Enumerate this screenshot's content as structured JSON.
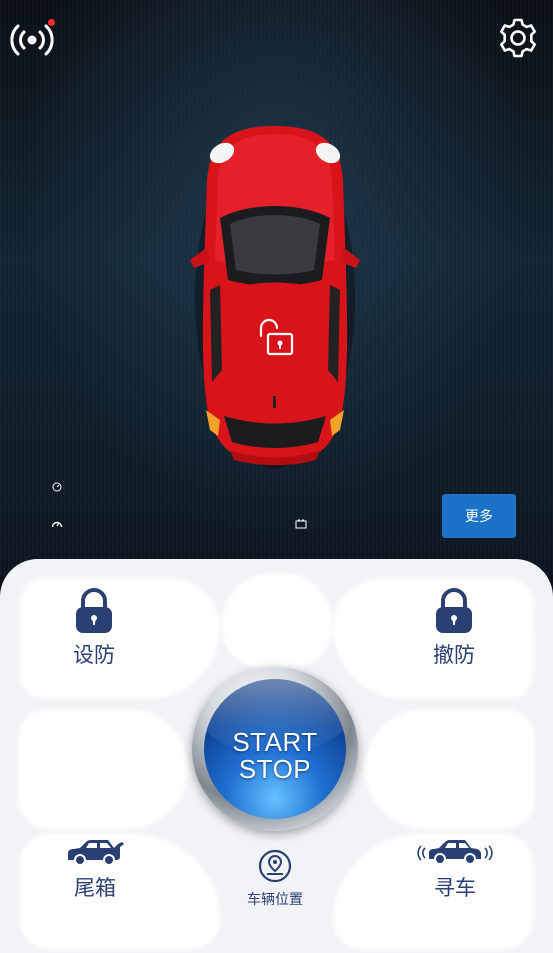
{
  "header": {
    "signal_icon": "signal-broadcast-icon",
    "settings_icon": "gear-icon"
  },
  "vehicle": {
    "lock_status_icon": "unlocked-padlock-icon",
    "more_label": "更多"
  },
  "controls": {
    "arm_label": "设防",
    "disarm_label": "撤防",
    "trunk_label": "尾箱",
    "find_car_label": "寻车",
    "location_label": "车辆位置",
    "start_stop_line1": "START",
    "start_stop_line2": "STOP"
  },
  "colors": {
    "accent": "#1a73c6",
    "label": "#2a3f72",
    "car": "#d8141a",
    "alert_dot": "#ff2a2a"
  }
}
